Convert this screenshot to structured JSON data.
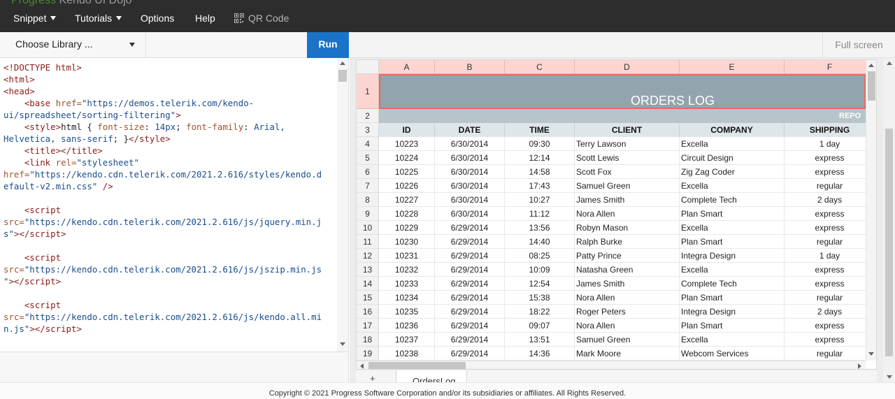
{
  "nav": {
    "brand_part1": "Progress",
    "brand_part2": "Kendo UI Dojo",
    "items": {
      "snippet": "Snippet",
      "tutorials": "Tutorials",
      "options": "Options",
      "help": "Help",
      "qr_code": "QR Code"
    }
  },
  "editor": {
    "library_select": "Choose Library ...",
    "run_label": "Run"
  },
  "preview": {
    "fullscreen_label": "Full screen"
  },
  "spreadsheet": {
    "columns": [
      "A",
      "B",
      "C",
      "D",
      "E",
      "F"
    ],
    "row_numbers": [
      "1",
      "2",
      "3",
      "4",
      "5",
      "6",
      "7",
      "8",
      "9",
      "10",
      "11",
      "12",
      "13",
      "14",
      "15",
      "16",
      "17",
      "18",
      "19"
    ],
    "title": "ORDERS LOG",
    "report_label": "REPO",
    "headers": [
      "ID",
      "DATE",
      "TIME",
      "CLIENT",
      "COMPANY",
      "SHIPPING"
    ],
    "rows": [
      [
        "10223",
        "6/30/2014",
        "09:30",
        "Terry Lawson",
        "Excella",
        "1 day"
      ],
      [
        "10224",
        "6/30/2014",
        "12:14",
        "Scott Lewis",
        "Circuit Design",
        "express"
      ],
      [
        "10225",
        "6/30/2014",
        "14:58",
        "Scott Fox",
        "Zig Zag Coder",
        "express"
      ],
      [
        "10226",
        "6/30/2014",
        "17:43",
        "Samuel Green",
        "Excella",
        "regular"
      ],
      [
        "10227",
        "6/30/2014",
        "10:27",
        "James Smith",
        "Complete Tech",
        "2 days"
      ],
      [
        "10228",
        "6/30/2014",
        "11:12",
        "Nora Allen",
        "Plan Smart",
        "express"
      ],
      [
        "10229",
        "6/29/2014",
        "13:56",
        "Robyn Mason",
        "Excella",
        "express"
      ],
      [
        "10230",
        "6/29/2014",
        "14:40",
        "Ralph Burke",
        "Plan Smart",
        "regular"
      ],
      [
        "10231",
        "6/29/2014",
        "08:25",
        "Patty Prince",
        "Integra Design",
        "1 day"
      ],
      [
        "10232",
        "6/29/2014",
        "10:09",
        "Natasha Green",
        "Excella",
        "express"
      ],
      [
        "10233",
        "6/29/2014",
        "12:54",
        "James Smith",
        "Complete Tech",
        "express"
      ],
      [
        "10234",
        "6/29/2014",
        "15:38",
        "Nora Allen",
        "Plan Smart",
        "regular"
      ],
      [
        "10235",
        "6/29/2014",
        "18:22",
        "Roger Peters",
        "Integra Design",
        "2 days"
      ],
      [
        "10236",
        "6/29/2014",
        "09:07",
        "Nora Allen",
        "Plan Smart",
        "express"
      ],
      [
        "10237",
        "6/29/2014",
        "13:51",
        "Samuel Green",
        "Excella",
        "express"
      ],
      [
        "10238",
        "6/29/2014",
        "14:36",
        "Mark Moore",
        "Webcom Services",
        "regular"
      ]
    ],
    "add_sheet": "+",
    "sheet_tab": "OrdersLog"
  },
  "footer": {
    "copyright": "Copyright © 2021 Progress Software Corporation and/or its subsidiaries or affiliates. All Rights Reserved."
  },
  "colors": {
    "nav_bg": "#2d2d2d",
    "run_button": "#1a73c8",
    "title_band": "#93a4ae",
    "selection_border": "#e86a5c",
    "header_highlight": "#fdd5d0"
  },
  "icons": [
    "caret-down-icon",
    "qr-code-icon",
    "scroll-up-icon",
    "scroll-down-icon",
    "scroll-left-icon",
    "scroll-right-icon"
  ]
}
